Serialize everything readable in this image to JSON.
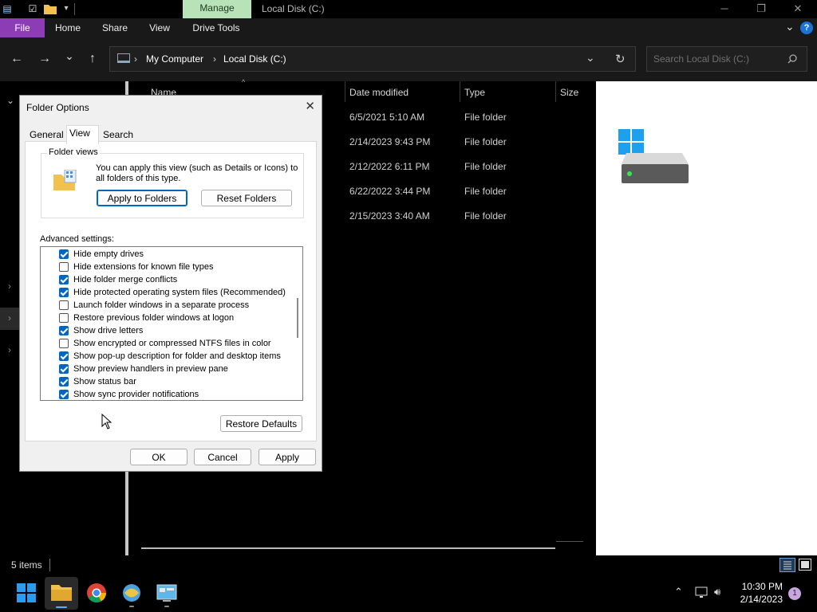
{
  "window": {
    "manage_tab": "Manage",
    "title": "Local Disk (C:)",
    "minimize": "─",
    "restore": "❐",
    "close": "✕"
  },
  "ribbon": {
    "file": "File",
    "home": "Home",
    "share": "Share",
    "view": "View",
    "drive_tools": "Drive Tools",
    "help": "?"
  },
  "nav": {
    "back": "←",
    "forward": "→",
    "recent": "⌄",
    "up": "↑",
    "crumbs": [
      "My Computer",
      "Local Disk (C:)"
    ],
    "search_placeholder": "Search Local Disk (C:)"
  },
  "list": {
    "columns": {
      "name": "Name",
      "date": "Date modified",
      "type": "Type",
      "size": "Size"
    },
    "rows": [
      {
        "date": "6/5/2021 5:10 AM",
        "type": "File folder"
      },
      {
        "date": "2/14/2023 9:43 PM",
        "type": "File folder"
      },
      {
        "date": "2/12/2022 6:11 PM",
        "type": "File folder"
      },
      {
        "date": "6/22/2022 3:44 PM",
        "type": "File folder"
      },
      {
        "date": "2/15/2023 3:40 AM",
        "type": "File folder"
      }
    ]
  },
  "status": {
    "items": "5 items"
  },
  "dialog": {
    "title": "Folder Options",
    "tabs": [
      "General",
      "View",
      "Search"
    ],
    "folder_views": {
      "legend": "Folder views",
      "description": "You can apply this view (such as Details or Icons) to all folders of this type.",
      "apply_button": "Apply to Folders",
      "reset_button": "Reset Folders"
    },
    "advanced_label": "Advanced settings:",
    "options": [
      {
        "label": "Hide empty drives",
        "checked": true
      },
      {
        "label": "Hide extensions for known file types",
        "checked": false
      },
      {
        "label": "Hide folder merge conflicts",
        "checked": true
      },
      {
        "label": "Hide protected operating system files (Recommended)",
        "checked": true
      },
      {
        "label": "Launch folder windows in a separate process",
        "checked": false
      },
      {
        "label": "Restore previous folder windows at logon",
        "checked": false
      },
      {
        "label": "Show drive letters",
        "checked": true
      },
      {
        "label": "Show encrypted or compressed NTFS files in color",
        "checked": false
      },
      {
        "label": "Show pop-up description for folder and desktop items",
        "checked": true
      },
      {
        "label": "Show preview handlers in preview pane",
        "checked": true
      },
      {
        "label": "Show status bar",
        "checked": true
      },
      {
        "label": "Show sync provider notifications",
        "checked": true
      }
    ],
    "restore_defaults": "Restore Defaults",
    "ok": "OK",
    "cancel": "Cancel",
    "apply": "Apply"
  },
  "taskbar": {
    "time": "10:30 PM",
    "date": "2/14/2023",
    "notification_count": "1"
  },
  "colors": {
    "file_tab": "#8c3cb5",
    "manage_tab": "#b8e3b8",
    "accent": "#0067c0"
  }
}
